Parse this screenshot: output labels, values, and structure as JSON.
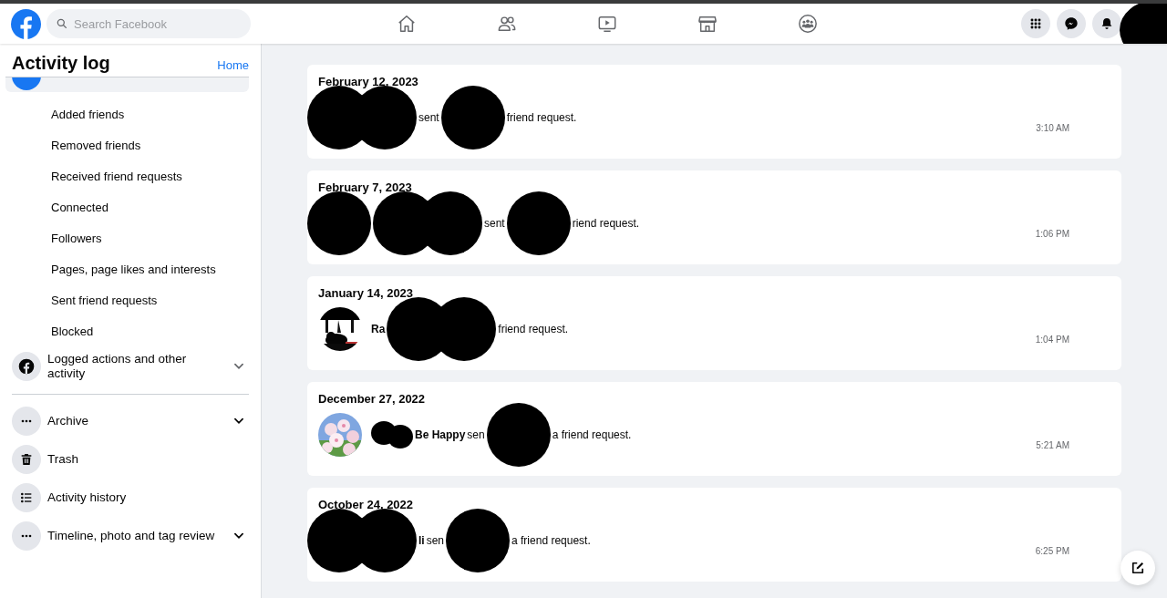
{
  "header": {
    "search": {
      "placeholder": "Search Facebook"
    },
    "profile_redacted": true
  },
  "sidebar": {
    "title": "Activity log",
    "home_link": "Home",
    "top_item": {
      "selected": true
    },
    "items": [
      {
        "kind": "filter",
        "label": "Added friends"
      },
      {
        "kind": "filter",
        "label": "Removed friends"
      },
      {
        "kind": "filter",
        "label": "Received friend requests"
      },
      {
        "kind": "filter",
        "label": "Connected"
      },
      {
        "kind": "filter",
        "label": "Followers"
      },
      {
        "kind": "filter",
        "label": "Pages, page likes and interests"
      },
      {
        "kind": "filter",
        "label": "Sent friend requests"
      },
      {
        "kind": "filter",
        "label": "Blocked"
      },
      {
        "kind": "section",
        "label": "Logged actions and other activity",
        "expandable": true,
        "divider_after": true
      },
      {
        "kind": "section",
        "label": "Archive",
        "expandable": true
      },
      {
        "kind": "section",
        "label": "Trash",
        "expandable": false
      },
      {
        "kind": "section",
        "label": "Activity history",
        "expandable": false
      },
      {
        "kind": "section",
        "label": "Timeline, photo and tag review",
        "expandable": true
      }
    ]
  },
  "entries": [
    {
      "date": "February 12, 2023",
      "time": "3:10 AM",
      "parts": [
        {
          "kind": "blots"
        },
        {
          "kind": "text",
          "text": "sent",
          "bold": false
        },
        {
          "kind": "blot"
        },
        {
          "kind": "text",
          "text": "friend request.",
          "bold": false
        }
      ]
    },
    {
      "date": "February 7, 2023",
      "time": "1:06 PM",
      "parts": [
        {
          "kind": "blot"
        },
        {
          "kind": "blots"
        },
        {
          "kind": "text",
          "text": "sent",
          "bold": false
        },
        {
          "kind": "blot"
        },
        {
          "kind": "text",
          "text": "riend request.",
          "bold": false
        }
      ]
    },
    {
      "date": "January 14, 2023",
      "time": "1:04 PM",
      "parts": [
        {
          "kind": "picture"
        },
        {
          "kind": "text",
          "text": "Ra",
          "bold": true
        },
        {
          "kind": "blots"
        },
        {
          "kind": "text",
          "text": "friend request.",
          "bold": false
        }
      ]
    },
    {
      "date": "December 27, 2022",
      "time": "5:21 AM",
      "parts": [
        {
          "kind": "picture"
        },
        {
          "kind": "smudge"
        },
        {
          "kind": "text",
          "text": "Be Happy",
          "bold": true
        },
        {
          "kind": "text",
          "text": "sen",
          "bold": false
        },
        {
          "kind": "blot"
        },
        {
          "kind": "text",
          "text": "a friend request.",
          "bold": false
        }
      ]
    },
    {
      "date": "October 24, 2022",
      "time": "6:25 PM",
      "parts": [
        {
          "kind": "blots"
        },
        {
          "kind": "text",
          "text": "li",
          "bold": true
        },
        {
          "kind": "text",
          "text": "sen",
          "bold": false
        },
        {
          "kind": "blot"
        },
        {
          "kind": "text",
          "text": "a friend request.",
          "bold": false
        }
      ]
    }
  ]
}
